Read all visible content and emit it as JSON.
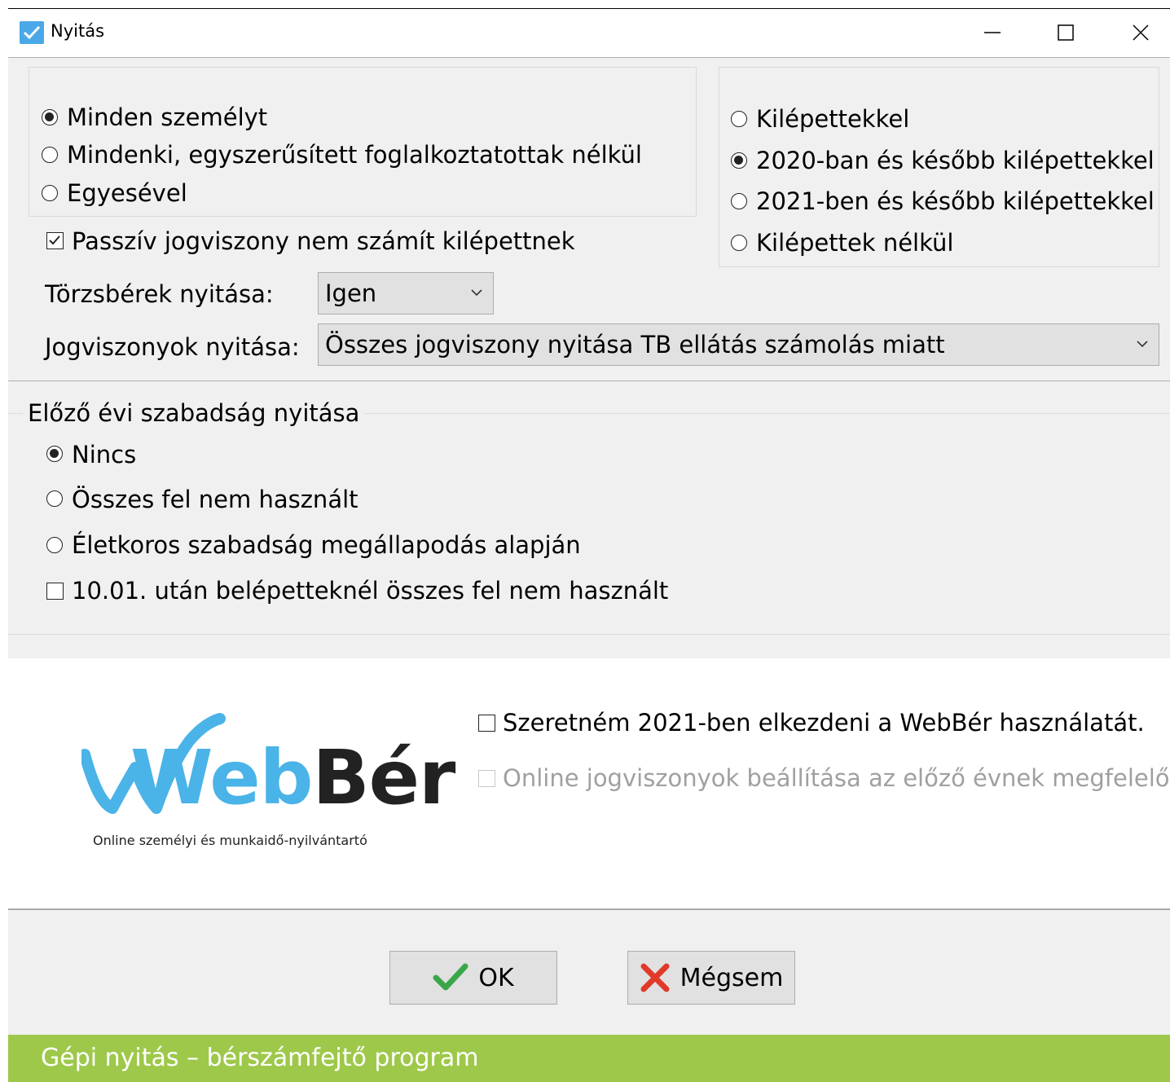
{
  "window": {
    "title": "Nyitás"
  },
  "scope": {
    "options": [
      "Minden személyt",
      "Mindenki, egyszerűsített foglalkoztatottak nélkül",
      "Egyesével"
    ],
    "selected": 0
  },
  "exited": {
    "options": [
      "Kilépettekkel",
      "2020-ban és később kilépettekkel",
      "2021-ben és később kilépettekkel",
      "Kilépettek nélkül"
    ],
    "selected": 1
  },
  "passive_check": {
    "label": "Passzív jogviszony nem számít kilépettnek",
    "checked": true
  },
  "torzsberek": {
    "label": "Törzsbérek nyitása:",
    "value": "Igen"
  },
  "jogviszonyok": {
    "label": "Jogviszonyok nyitása:",
    "value": "Összes jogviszony nyitása TB ellátás számolás miatt"
  },
  "leave": {
    "title": "Előző évi szabadság nyitása",
    "options": [
      "Nincs",
      "Összes fel nem használt",
      "Életkoros szabadság megállapodás alapján"
    ],
    "selected": 0,
    "check_label": "10.01. után belépetteknél összes fel nem használt",
    "check_checked": false
  },
  "logo": {
    "text_a": "Web",
    "text_b": "Bér",
    "tagline": "Online személyi és munkaidő-nyilvántartó"
  },
  "webber": {
    "start_label": "Szeretném 2021-ben elkezdeni a WebBér használatát.",
    "online_label": "Online jogviszonyok beállítása az előző évnek megfelelően"
  },
  "buttons": {
    "ok": "OK",
    "cancel": "Mégsem"
  },
  "footer": {
    "text": "Gépi nyitás – bérszámfejtő program"
  },
  "colors": {
    "footer": "#9ec84a",
    "logo_blue": "#4ab3e8",
    "ok_green": "#3aa64a",
    "cancel_red": "#e03a2a"
  }
}
